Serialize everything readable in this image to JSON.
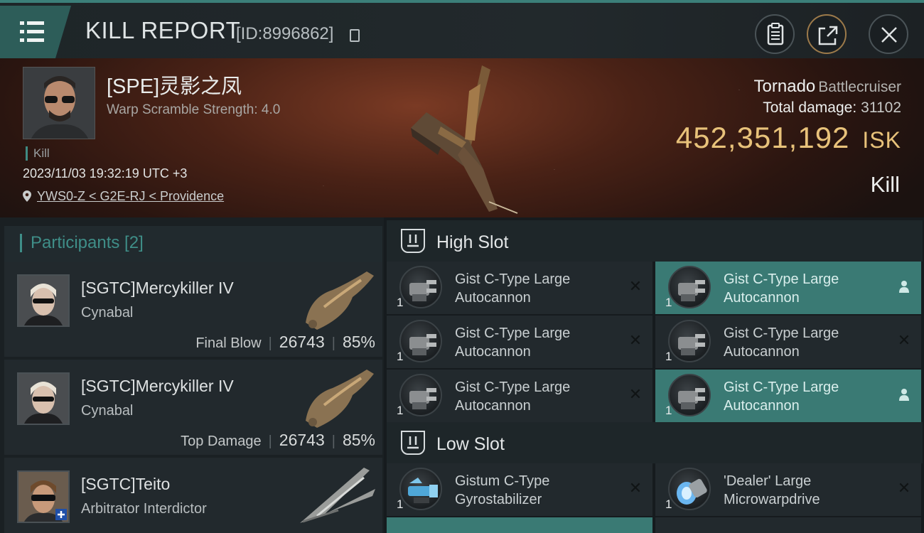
{
  "header": {
    "title": "KILL REPORT",
    "report_id": "[ID:8996862]",
    "icons": [
      "menu-icon",
      "copy-icon",
      "clipboard-icon",
      "share-icon",
      "close-icon"
    ]
  },
  "victim": {
    "name": "[SPE]灵影之凤",
    "subtitle": "Warp Scramble Strength: 4.0",
    "kill_tag": "Kill",
    "datetime": "2023/11/03 19:32:19 UTC +3",
    "location": "YWS0-Z < G2E-RJ < Providence",
    "ship_name": "Tornado",
    "ship_class": "Battlecruiser",
    "total_damage_label": "Total damage:",
    "total_damage": "31102",
    "isk_value": "452,351,192",
    "isk_unit": "ISK",
    "result": "Kill"
  },
  "participants": {
    "title": "Participants [2]",
    "items": [
      {
        "name": "[SGTC]Mercykiller IV",
        "ship": "Cynabal",
        "role": "Final Blow",
        "damage": "26743",
        "percent": "85%"
      },
      {
        "name": "[SGTC]Mercykiller IV",
        "ship": "Cynabal",
        "role": "Top Damage",
        "damage": "26743",
        "percent": "85%"
      },
      {
        "name": "[SGTC]Teito",
        "ship": "Arbitrator Interdictor",
        "role": "",
        "damage": "",
        "percent": ""
      }
    ]
  },
  "fitting": {
    "high_slot": {
      "label": "High Slot",
      "modules": [
        {
          "qty": "1",
          "line1": "Gist C-Type Large",
          "line2": "Autocannon",
          "state": "destroyed"
        },
        {
          "qty": "1",
          "line1": "Gist C-Type Large",
          "line2": "Autocannon",
          "state": "dropped"
        },
        {
          "qty": "1",
          "line1": "Gist C-Type Large",
          "line2": "Autocannon",
          "state": "destroyed"
        },
        {
          "qty": "1",
          "line1": "Gist C-Type Large",
          "line2": "Autocannon",
          "state": "destroyed"
        },
        {
          "qty": "1",
          "line1": "Gist C-Type Large",
          "line2": "Autocannon",
          "state": "destroyed"
        },
        {
          "qty": "1",
          "line1": "Gist C-Type Large",
          "line2": "Autocannon",
          "state": "dropped"
        }
      ]
    },
    "low_slot": {
      "label": "Low Slot",
      "modules": [
        {
          "qty": "1",
          "line1": "Gistum C-Type",
          "line2": "Gyrostabilizer",
          "state": "destroyed"
        },
        {
          "qty": "1",
          "line1": "'Dealer' Large",
          "line2": "Microwarpdrive",
          "state": "destroyed"
        }
      ]
    }
  },
  "colors": {
    "accent": "#3f8e88",
    "isk": "#e8c27a",
    "active_module": "#3a7a74"
  }
}
